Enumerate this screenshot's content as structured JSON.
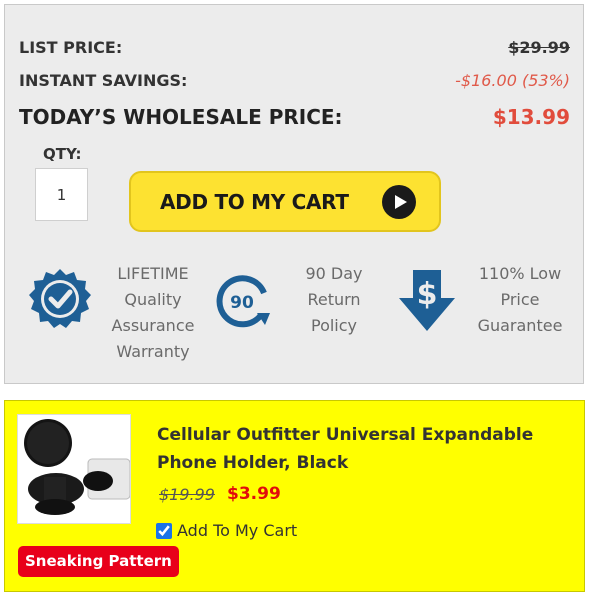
{
  "pricing": {
    "list_price_label": "LIST PRICE:",
    "list_price_value": "$29.99",
    "instant_savings_label": "INSTANT SAVINGS:",
    "instant_savings_value": "-$16.00 (53%)",
    "todays_price_label": "TODAY’S WHOLESALE PRICE:",
    "todays_price_value": "$13.99"
  },
  "quantity": {
    "label": "QTY:",
    "value": "1"
  },
  "cart_button": {
    "label": "ADD TO MY CART",
    "icon": "play-arrow-icon"
  },
  "badges": [
    {
      "icon": "checkmark-seal-icon",
      "lines": [
        "LIFETIME",
        "Quality",
        "Assurance",
        "Warranty"
      ]
    },
    {
      "icon": "90-day-return-icon",
      "icon_text": "90",
      "lines": [
        "90 Day",
        "Return",
        "Policy"
      ]
    },
    {
      "icon": "dollar-down-arrow-icon",
      "lines": [
        "110% Low",
        "Price",
        "Guarantee"
      ]
    }
  ],
  "addon": {
    "title": "Cellular Outfitter Universal Expandable Phone Holder, Black",
    "old_price": "$19.99",
    "new_price": "$3.99",
    "checkbox_label": "Add To My Cart",
    "checked": true,
    "tag": "Sneaking Pattern"
  },
  "colors": {
    "panel_bg": "#ececec",
    "price_red": "#e14c3c",
    "button_yellow": "#fde231",
    "addon_bg": "#ffff00",
    "badge_blue": "#1e5f95",
    "tag_red": "#e8001a"
  }
}
